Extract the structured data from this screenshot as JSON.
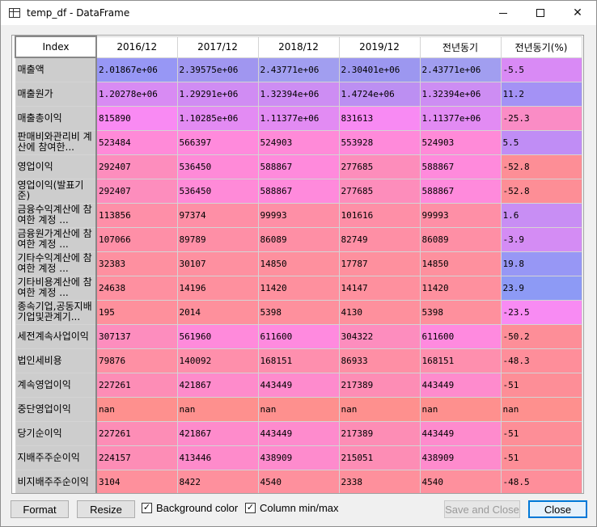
{
  "window": {
    "title": "temp_df - DataFrame",
    "minimize_glyph": "—",
    "close_glyph": "✕"
  },
  "table": {
    "index_header": "Index",
    "columns": [
      "2016/12",
      "2017/12",
      "2018/12",
      "2019/12",
      "전년동기",
      "전년동기(%)"
    ],
    "rows": [
      {
        "label": "매출액",
        "values": [
          "2.01867e+06",
          "2.39575e+06",
          "2.43771e+06",
          "2.30401e+06",
          "2.43771e+06",
          "-5.5"
        ],
        "colors": [
          "#9797f5",
          "#a096f0",
          "#a19ef0",
          "#9c97f0",
          "#a19ef0",
          "#d98af5"
        ]
      },
      {
        "label": "매출원가",
        "values": [
          "1.20278e+06",
          "1.29291e+06",
          "1.32394e+06",
          "1.4724e+06",
          "1.32394e+06",
          "11.2"
        ],
        "colors": [
          "#d88bf3",
          "#d08cf3",
          "#cd8df3",
          "#bc8ff2",
          "#cd8df3",
          "#a492f5"
        ]
      },
      {
        "label": "매출총이익",
        "values": [
          "815890",
          "1.10285e+06",
          "1.11377e+06",
          "831613",
          "1.11377e+06",
          "-25.3"
        ],
        "colors": [
          "#f98af3",
          "#e38bf3",
          "#e28bf3",
          "#f88af3",
          "#e28bf3",
          "#fa8cc5"
        ]
      },
      {
        "label": "판매비와관리비 계산에 참여한...",
        "values": [
          "523484",
          "566397",
          "524903",
          "553928",
          "524903",
          "5.5"
        ],
        "colors": [
          "#ff8ad8",
          "#ff8adc",
          "#ff8ad8",
          "#ff8ada",
          "#ff8ad8",
          "#c08df5"
        ]
      },
      {
        "label": "영업이익",
        "values": [
          "292407",
          "536450",
          "588867",
          "277685",
          "588867",
          "-52.8"
        ],
        "colors": [
          "#fd8dbd",
          "#ff8ad8",
          "#ff8adc",
          "#fd8dbb",
          "#ff8adc",
          "#fd8e96"
        ]
      },
      {
        "label": "영업이익(발표기준)",
        "values": [
          "292407",
          "536450",
          "588867",
          "277685",
          "588867",
          "-52.8"
        ],
        "colors": [
          "#fd8dbd",
          "#ff8ad8",
          "#ff8adc",
          "#fd8dbb",
          "#ff8adc",
          "#fd8e96"
        ]
      },
      {
        "label": "금융수익계산에 참여한 계정 ...",
        "values": [
          "113856",
          "97374",
          "99993",
          "101616",
          "99993",
          "1.6"
        ],
        "colors": [
          "#fe8fa8",
          "#fe8fa6",
          "#fe8fa6",
          "#fe8fa7",
          "#fe8fa6",
          "#c88ef4"
        ]
      },
      {
        "label": "금융원가계산에 참여한 계정 ...",
        "values": [
          "107066",
          "89789",
          "86089",
          "82749",
          "86089",
          "-3.9"
        ],
        "colors": [
          "#fe8fa7",
          "#fe8fa6",
          "#fe8fa5",
          "#fe8fa5",
          "#fe8fa5",
          "#d48cf4"
        ]
      },
      {
        "label": "기타수익계산에 참여한 계정 ...",
        "values": [
          "32383",
          "30107",
          "14850",
          "17787",
          "14850",
          "19.8"
        ],
        "colors": [
          "#fe90a0",
          "#fe90a0",
          "#fe909e",
          "#fe909e",
          "#fe909e",
          "#9797f5"
        ]
      },
      {
        "label": "기타비용계산에 참여한 계정 ...",
        "values": [
          "24638",
          "14196",
          "11420",
          "14147",
          "11420",
          "23.9"
        ],
        "colors": [
          "#fe90a0",
          "#fe909e",
          "#fe909e",
          "#fe909e",
          "#fe909e",
          "#8d9af5"
        ]
      },
      {
        "label": "종속기업,공동지배기업및관계기...",
        "values": [
          "195",
          "2014",
          "5398",
          "4130",
          "5398",
          "-23.5"
        ],
        "colors": [
          "#fe909c",
          "#fe909c",
          "#fe909d",
          "#fe909d",
          "#fe909d",
          "#f88bf3"
        ]
      },
      {
        "label": "세전계속사업이익",
        "values": [
          "307137",
          "561960",
          "611600",
          "304322",
          "611600",
          "-50.2"
        ],
        "colors": [
          "#fd8dbe",
          "#ff8adb",
          "#ff8adf",
          "#fd8dbe",
          "#ff8adf",
          "#fd8e98"
        ]
      },
      {
        "label": "법인세비용",
        "values": [
          "79876",
          "140092",
          "168151",
          "86933",
          "168151",
          "-48.3"
        ],
        "colors": [
          "#fe90a4",
          "#fe8fab",
          "#fe8fae",
          "#fe8fa5",
          "#fe8fae",
          "#fe8e9a"
        ]
      },
      {
        "label": "계속영업이익",
        "values": [
          "227261",
          "421867",
          "443449",
          "217389",
          "443449",
          "-51"
        ],
        "colors": [
          "#fd8db6",
          "#fe8bcb",
          "#fe8bcd",
          "#fd8db5",
          "#fe8bcd",
          "#fd8e97"
        ]
      },
      {
        "label": "중단영업이익",
        "values": [
          "nan",
          "nan",
          "nan",
          "nan",
          "nan",
          "nan"
        ],
        "colors": [
          "#fe908e",
          "#fe908e",
          "#fe908e",
          "#fe908e",
          "#fe908e",
          "#fe908e"
        ]
      },
      {
        "label": "당기순이익",
        "values": [
          "227261",
          "421867",
          "443449",
          "217389",
          "443449",
          "-51"
        ],
        "colors": [
          "#fd8db6",
          "#fe8bcb",
          "#fe8bcd",
          "#fd8db5",
          "#fe8bcd",
          "#fd8e97"
        ]
      },
      {
        "label": "지배주주순이익",
        "values": [
          "224157",
          "413446",
          "438909",
          "215051",
          "438909",
          "-51"
        ],
        "colors": [
          "#fd8db6",
          "#fe8bcb",
          "#fe8bcd",
          "#fd8db5",
          "#fe8bcd",
          "#fd8e97"
        ]
      },
      {
        "label": "비지배주주순이익",
        "values": [
          "3104",
          "8422",
          "4540",
          "2338",
          "4540",
          "-48.5"
        ],
        "colors": [
          "#fe909c",
          "#fe909d",
          "#fe909d",
          "#fe909c",
          "#fe909d",
          "#fe8e9a"
        ]
      }
    ]
  },
  "footer": {
    "format_label": "Format",
    "resize_label": "Resize",
    "background_color_label": "Background color",
    "background_color_checked": true,
    "column_minmax_label": "Column min/max",
    "column_minmax_checked": true,
    "save_close_label": "Save and Close",
    "close_label": "Close"
  }
}
